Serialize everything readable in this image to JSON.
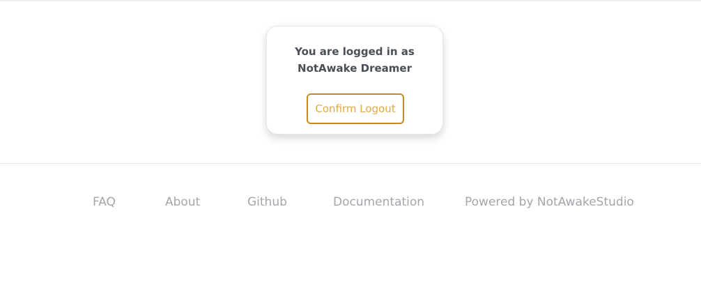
{
  "card": {
    "message_line1": "You are logged in as",
    "message_line2": "NotAwake Dreamer",
    "logout_button_label": "Confirm Logout"
  },
  "footer": {
    "links": [
      {
        "label": "FAQ"
      },
      {
        "label": "About"
      },
      {
        "label": "Github"
      },
      {
        "label": "Documentation"
      },
      {
        "label": "Powered by NotAwakeStudio"
      }
    ]
  },
  "colors": {
    "accent_border": "#c58a24",
    "accent_text": "#e2a93b",
    "message_text": "#4a4f56",
    "footer_text": "#a2a6ab"
  }
}
